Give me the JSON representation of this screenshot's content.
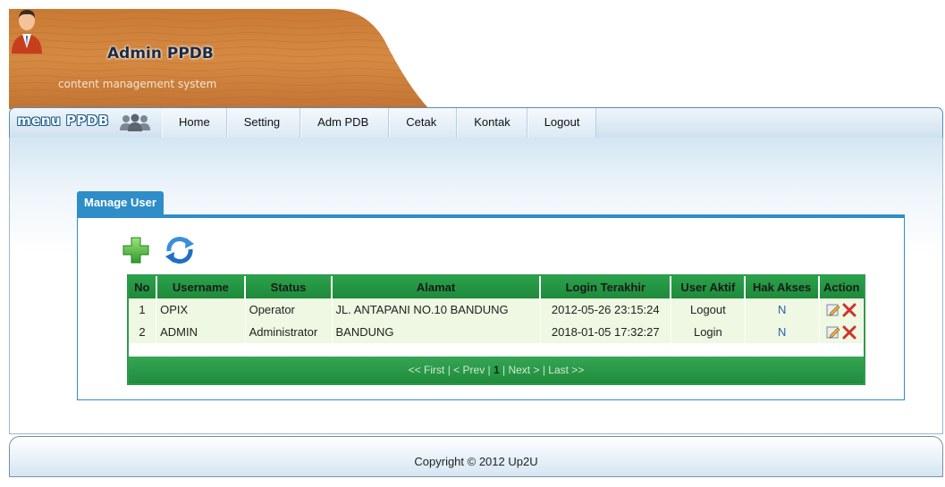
{
  "header": {
    "title": "Admin PPDB",
    "subtitle": "content management system"
  },
  "nav": {
    "brand": "menu PPDB",
    "items": [
      {
        "label": "Home",
        "caret": false
      },
      {
        "label": "Setting",
        "caret": true
      },
      {
        "label": "Adm PDB",
        "caret": true
      },
      {
        "label": "Cetak",
        "caret": true
      },
      {
        "label": "Kontak",
        "caret": false
      },
      {
        "label": "Logout",
        "caret": false
      }
    ]
  },
  "panel": {
    "tab_label": "Manage User"
  },
  "table": {
    "columns": [
      "No",
      "Username",
      "Status",
      "Alamat",
      "Login Terakhir",
      "User Aktif",
      "Hak Akses",
      "Action"
    ],
    "rows": [
      {
        "no": "1",
        "username": "OPIX",
        "status": "Operator",
        "alamat": "JL. ANTAPANI NO.10 BANDUNG",
        "login_terakhir": "2012-05-26 23:15:24",
        "user_aktif": "Logout",
        "hak_akses": "N"
      },
      {
        "no": "2",
        "username": "ADMIN",
        "status": "Administrator",
        "alamat": "BANDUNG",
        "login_terakhir": "2018-01-05 17:32:27",
        "user_aktif": "Login",
        "hak_akses": "N"
      }
    ],
    "pager": {
      "first": "<< First",
      "prev": "< Prev",
      "current": "1",
      "next": "Next >",
      "last": "Last >>"
    }
  },
  "footer": {
    "copyright": "Copyright © 2012 Up2U"
  },
  "colors": {
    "accent_blue": "#2f8dc8",
    "grid_green": "#2aa14a",
    "row_bg": "#eef8e2",
    "delete_red": "#d0312d"
  },
  "icons": [
    "user-avatar-icon",
    "people-group-icon",
    "add-icon",
    "refresh-icon",
    "edit-icon",
    "delete-icon"
  ]
}
